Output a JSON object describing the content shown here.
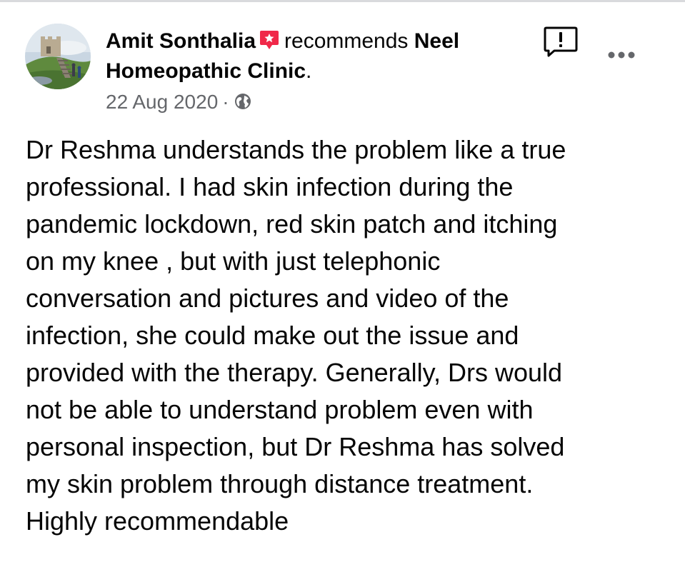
{
  "author": {
    "name": "Amit Sonthalia",
    "avatar_icon": "castle-photo-avatar"
  },
  "recommendation": {
    "icon": "recommend-star-icon",
    "icon_color": "#f02849",
    "verb": "recommends",
    "page_name_line1": "Neel",
    "page_name_line2": "Homeopathic Clinic",
    "trailing": "."
  },
  "meta": {
    "date": "22 Aug 2020",
    "separator": "·",
    "audience_icon": "globe-icon"
  },
  "actions": {
    "report_icon": "report-icon",
    "more_icon": "more-options-icon"
  },
  "post": {
    "lines": [
      "Dr Reshma understands the problem like a true",
      "professional. I had skin infection during the",
      "pandemic lockdown, red skin patch and itching",
      "on my knee , but with just telephonic",
      "conversation and pictures and video of the",
      "infection, she could make out the issue and",
      "provided with the therapy. Generally, Drs would",
      "not be able to understand problem even with",
      "personal inspection, but Dr Reshma has solved",
      "my skin problem through distance treatment.",
      "Highly recommendable"
    ]
  },
  "colors": {
    "text_primary": "#050505",
    "text_secondary": "#65676b",
    "accent_red": "#f02849"
  }
}
